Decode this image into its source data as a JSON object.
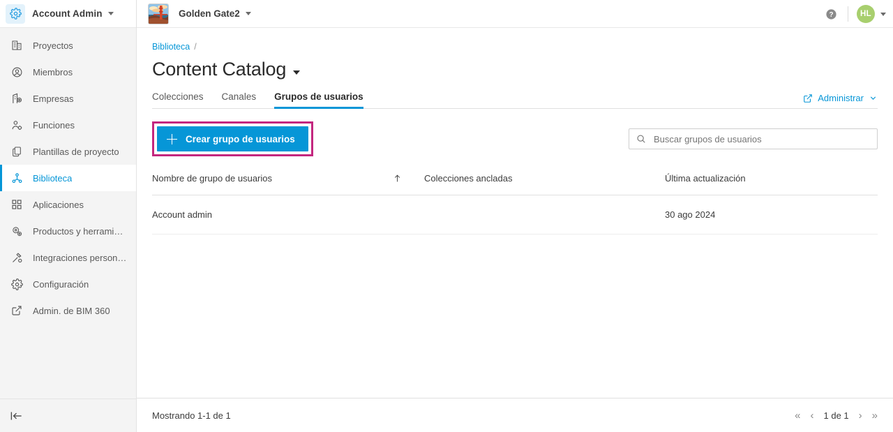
{
  "topbar": {
    "account_label": "Account Admin",
    "account_icon": "gear-icon",
    "project_name": "Golden Gate2",
    "project_thumb_icon": "golden-gate-bridge-thumbnail",
    "help_icon": "help-circle-icon",
    "avatar_initials": "HL",
    "avatar_color": "#a8cf6e",
    "caret_icon": "chevron-down-icon"
  },
  "sidebar": {
    "items": [
      {
        "label": "Proyectos",
        "icon": "building-icon",
        "active": false
      },
      {
        "label": "Miembros",
        "icon": "user-circle-icon",
        "active": false
      },
      {
        "label": "Empresas",
        "icon": "company-badge-icon",
        "active": false
      },
      {
        "label": "Funciones",
        "icon": "user-gear-icon",
        "active": false
      },
      {
        "label": "Plantillas de proyecto",
        "icon": "copy-pages-icon",
        "active": false
      },
      {
        "label": "Biblioteca",
        "icon": "library-node-icon",
        "active": true
      },
      {
        "label": "Aplicaciones",
        "icon": "apps-grid-icon",
        "active": false
      },
      {
        "label": "Productos y herramien…",
        "icon": "gear-cluster-icon",
        "active": false
      },
      {
        "label": "Integraciones persona…",
        "icon": "hammer-icon",
        "active": false
      },
      {
        "label": "Configuración",
        "icon": "gear-icon",
        "active": false
      },
      {
        "label": "Admin. de BIM 360",
        "icon": "external-link-icon",
        "active": false
      }
    ],
    "collapse_icon": "collapse-sidebar-icon",
    "active_accent": "#0696d7"
  },
  "breadcrumb": {
    "root": "Biblioteca",
    "separator": "/"
  },
  "page": {
    "title": "Content Catalog",
    "title_caret_icon": "caret-down-icon"
  },
  "tabs": [
    {
      "label": "Colecciones",
      "active": false
    },
    {
      "label": "Canales",
      "active": false
    },
    {
      "label": "Grupos de usuarios",
      "active": true
    }
  ],
  "manage": {
    "label": "Administrar",
    "link_icon": "external-link-icon",
    "chevron_icon": "chevron-down-icon",
    "color": "#0696d7"
  },
  "toolbar": {
    "create_label": "Crear grupo de usuarios",
    "create_icon": "plus-icon",
    "create_button_color": "#0696d7",
    "highlight_color": "#c3277f",
    "search_placeholder": "Buscar grupos de usuarios",
    "search_value": "",
    "search_icon": "search-icon"
  },
  "table": {
    "columns": [
      "Nombre de grupo de usuarios",
      "Colecciones ancladas",
      "Última actualización"
    ],
    "sort_icon": "arrow-up-icon",
    "rows": [
      {
        "name": "Account admin",
        "pinned_collections": "",
        "last_updated": "30 ago 2024"
      }
    ]
  },
  "footer": {
    "showing": "Mostrando 1-1 de 1",
    "page_label": "1 de 1",
    "first_icon": "«",
    "prev_icon": "‹",
    "next_icon": "›",
    "last_icon": "»"
  }
}
